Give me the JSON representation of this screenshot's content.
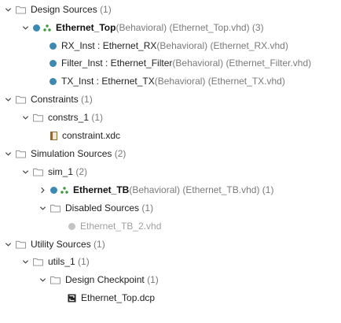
{
  "tree": {
    "design_sources": {
      "label": "Design Sources",
      "count": "(1)"
    },
    "ethernet_top": {
      "name": "Ethernet_Top",
      "arch": "(Behavioral)",
      "file": "(Ethernet_Top.vhd)",
      "count": "(3)"
    },
    "rx_inst": {
      "name": "RX_Inst : Ethernet_RX",
      "arch": "(Behavioral)",
      "file": "(Ethernet_RX.vhd)"
    },
    "filter_inst": {
      "name": "Filter_Inst : Ethernet_Filter",
      "arch": "(Behavioral)",
      "file": "(Ethernet_Filter.vhd)"
    },
    "tx_inst": {
      "name": "TX_Inst : Ethernet_TX",
      "arch": "(Behavioral)",
      "file": "(Ethernet_TX.vhd)"
    },
    "constraints": {
      "label": "Constraints",
      "count": "(1)"
    },
    "constrs_1": {
      "label": "constrs_1",
      "count": "(1)"
    },
    "constraint_file": {
      "label": "constraint.xdc"
    },
    "simulation_sources": {
      "label": "Simulation Sources",
      "count": "(2)"
    },
    "sim_1": {
      "label": "sim_1",
      "count": "(2)"
    },
    "ethernet_tb": {
      "name": "Ethernet_TB",
      "arch": "(Behavioral)",
      "file": "(Ethernet_TB.vhd)",
      "count": "(1)"
    },
    "disabled_sources": {
      "label": "Disabled Sources",
      "count": "(1)"
    },
    "ethernet_tb_2": {
      "label": "Ethernet_TB_2.vhd"
    },
    "utility_sources": {
      "label": "Utility Sources",
      "count": "(1)"
    },
    "utils_1": {
      "label": "utils_1",
      "count": "(1)"
    },
    "design_checkpoint": {
      "label": "Design Checkpoint",
      "count": "(1)"
    },
    "checkpoint_file": {
      "label": "Ethernet_Top.dcp"
    }
  },
  "colors": {
    "module_dot": "#3c8ab3",
    "hierarchy": "#3a9a3a",
    "disabled": "#c4c4c4"
  },
  "icons": {
    "expanded": "chevron-down-icon",
    "collapsed": "chevron-right-icon",
    "folder": "folder-icon"
  }
}
